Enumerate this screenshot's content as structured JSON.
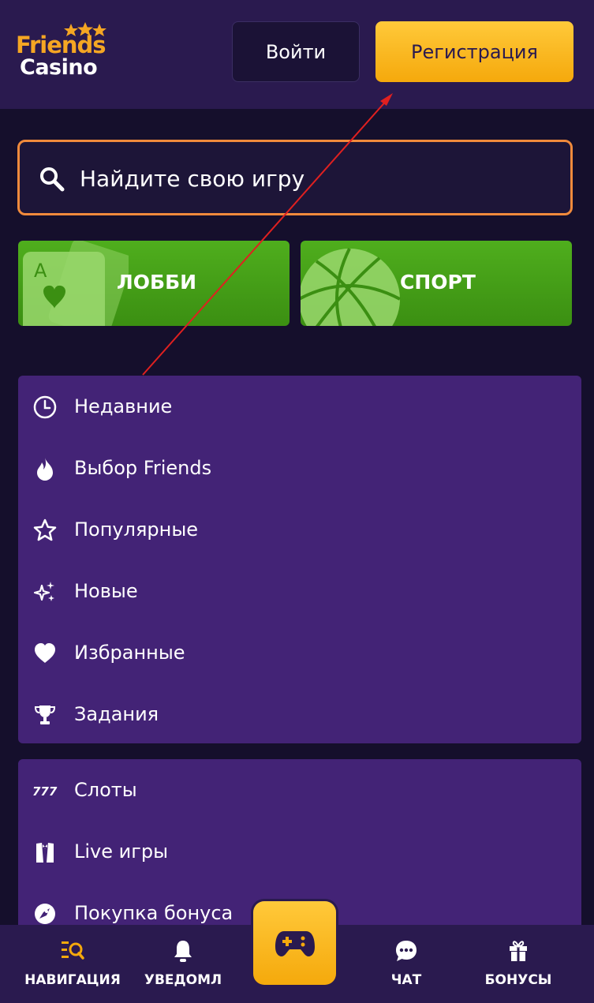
{
  "header": {
    "logo_top": "Friends",
    "logo_bottom": "Casino",
    "login_label": "Войти",
    "register_label": "Регистрация"
  },
  "search": {
    "placeholder": "Найдите свою игру",
    "icon": "search-icon"
  },
  "tiles": [
    {
      "label": "ЛОББИ",
      "icon": "playing-cards-icon"
    },
    {
      "label": "СПОРТ",
      "icon": "basketball-icon"
    }
  ],
  "menu_primary": [
    {
      "label": "Недавние",
      "icon": "clock-icon"
    },
    {
      "label": "Выбор Friends",
      "icon": "flame-icon"
    },
    {
      "label": "Популярные",
      "icon": "star-icon"
    },
    {
      "label": "Новые",
      "icon": "sparkle-icon"
    },
    {
      "label": "Избранные",
      "icon": "heart-icon"
    },
    {
      "label": "Задания",
      "icon": "trophy-icon"
    }
  ],
  "menu_secondary": [
    {
      "label": "Слоты",
      "icon": "slots-777-icon"
    },
    {
      "label": "Live игры",
      "icon": "tuxedo-icon"
    },
    {
      "label": "Покупка бонуса",
      "icon": "rocket-icon"
    }
  ],
  "bottom_nav": {
    "navigation_label": "НАВИГАЦИЯ",
    "notifications_label": "УВЕДОМЛ",
    "chat_label": "ЧАТ",
    "bonuses_label": "БОНУСЫ",
    "center_icon": "gamepad-icon"
  },
  "colors": {
    "background": "#150f2c",
    "header": "#2a1a4f",
    "panel": "#432376",
    "accent": "#f5a90c",
    "green": "#45a016",
    "search_border": "#f08a3c",
    "annotation_arrow": "#e02020"
  }
}
